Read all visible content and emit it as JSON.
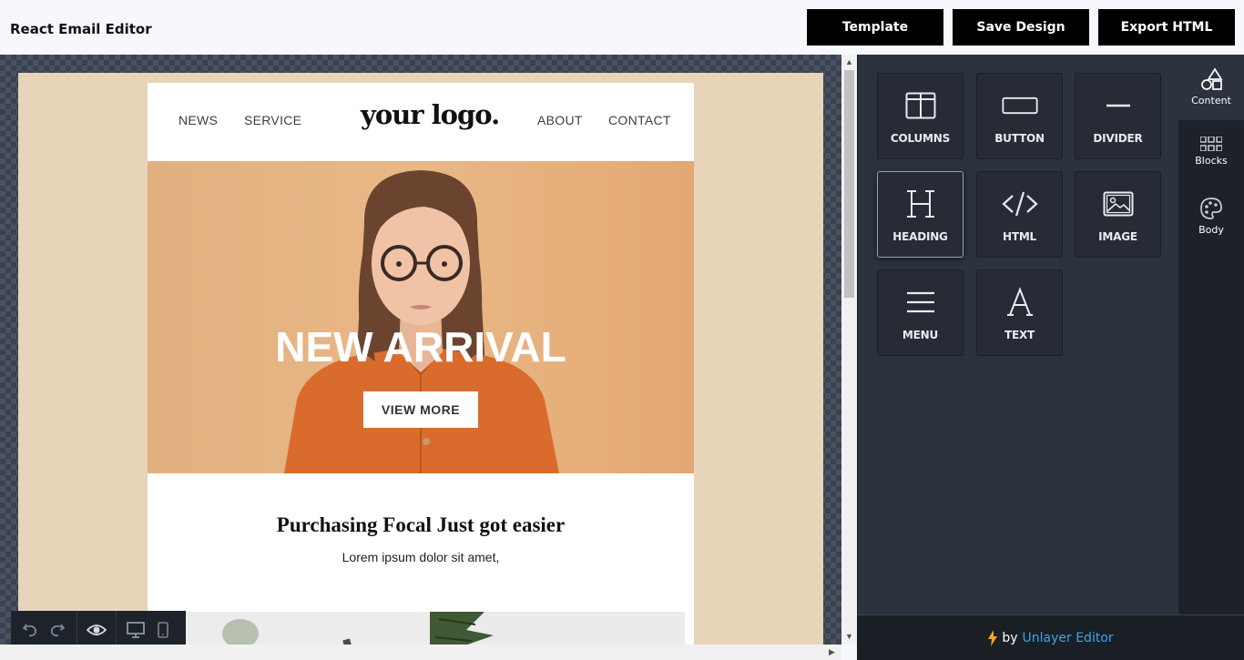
{
  "header": {
    "title": "React Email Editor",
    "buttons": {
      "template": "Template",
      "save": "Save Design",
      "export": "Export HTML"
    }
  },
  "email": {
    "nav": {
      "left": [
        "NEWS",
        "SERVICE"
      ],
      "logo": "your logo.",
      "right": [
        "ABOUT",
        "CONTACT"
      ]
    },
    "hero": {
      "title": "NEW ARRIVAL",
      "button": "VIEW MORE"
    },
    "content": {
      "title": "Purchasing Focal Just got easier",
      "text": "Lorem ipsum dolor sit amet,"
    }
  },
  "panel": {
    "tools": [
      {
        "label": "COLUMNS",
        "icon": "columns-icon"
      },
      {
        "label": "BUTTON",
        "icon": "button-icon"
      },
      {
        "label": "DIVIDER",
        "icon": "divider-icon"
      },
      {
        "label": "HEADING",
        "icon": "heading-icon"
      },
      {
        "label": "HTML",
        "icon": "code-icon"
      },
      {
        "label": "IMAGE",
        "icon": "image-icon"
      },
      {
        "label": "MENU",
        "icon": "menu-icon"
      },
      {
        "label": "TEXT",
        "icon": "text-icon"
      }
    ],
    "tabs": [
      {
        "label": "Content",
        "icon": "shapes-icon"
      },
      {
        "label": "Blocks",
        "icon": "blocks-icon"
      },
      {
        "label": "Body",
        "icon": "palette-icon"
      }
    ]
  },
  "footer": {
    "prefix": "by",
    "brand": "Unlayer Editor"
  },
  "colors": {
    "accent": "#3aa6e8",
    "panel": "#2c323e",
    "email_background": "#e7d4b9",
    "button": "#000000"
  }
}
